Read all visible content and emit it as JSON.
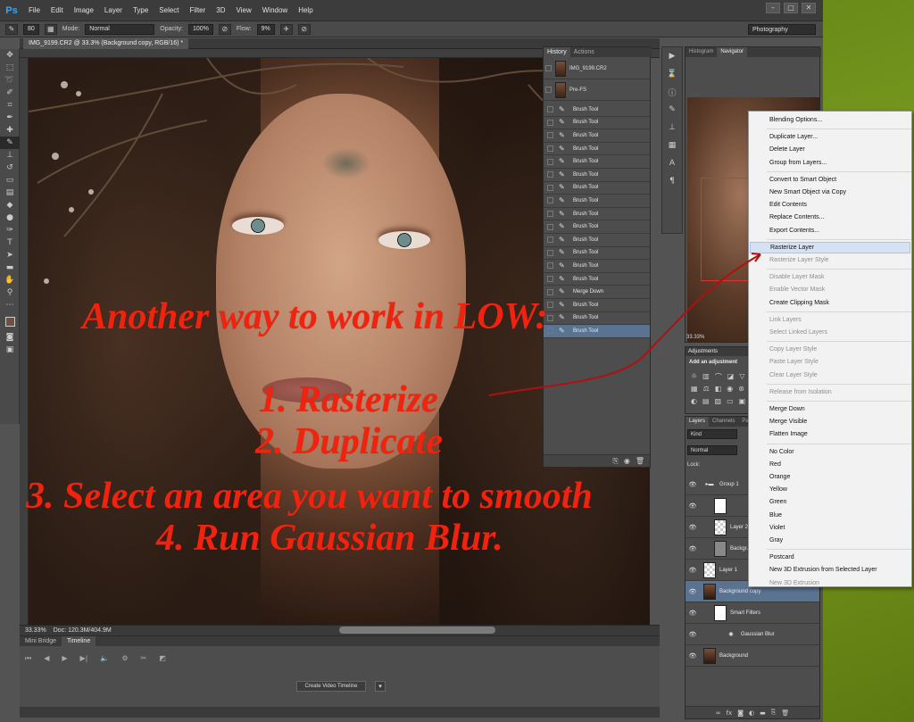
{
  "app": {
    "logo": "Ps"
  },
  "menubar": {
    "items": [
      "File",
      "Edit",
      "Image",
      "Layer",
      "Type",
      "Select",
      "Filter",
      "3D",
      "View",
      "Window",
      "Help"
    ]
  },
  "options_bar": {
    "brush_size": "80",
    "mode_label": "Mode:",
    "mode_value": "Normal",
    "opacity_label": "Opacity:",
    "opacity_value": "100%",
    "flow_label": "Flow:",
    "flow_value": "9%",
    "workspace": "Photography"
  },
  "document": {
    "tab_title": "IMG_9199.CR2 @ 33.3% (Background copy, RGB/16) *",
    "zoom": "33.33%",
    "doc_size": "Doc: 120.3M/404.9M"
  },
  "timeline": {
    "tabs": [
      "Mini Bridge",
      "Timeline"
    ],
    "create_button": "Create Video Timeline"
  },
  "history": {
    "tabs": [
      "History",
      "Actions"
    ],
    "snapshots": [
      "IMG_9199.CR2",
      "Pre-FS"
    ],
    "states": [
      "Brush Tool",
      "Brush Tool",
      "Brush Tool",
      "Brush Tool",
      "Brush Tool",
      "Brush Tool",
      "Brush Tool",
      "Brush Tool",
      "Brush Tool",
      "Brush Tool",
      "Brush Tool",
      "Brush Tool",
      "Brush Tool",
      "Brush Tool",
      "Merge Down",
      "Brush Tool",
      "Brush Tool",
      "Brush Tool"
    ],
    "selected_index": 17
  },
  "navigator": {
    "tabs": [
      "Histogram",
      "Navigator"
    ],
    "zoom": "33.33%"
  },
  "adjustments": {
    "tab": "Adjustments",
    "title": "Add an adjustment"
  },
  "layers": {
    "tabs": [
      "Layers",
      "Channels",
      "Paths"
    ],
    "filter": "Kind",
    "blend": "Normal",
    "lock_label": "Lock:",
    "rows": [
      {
        "name": "Group 1",
        "thumb": "none"
      },
      {
        "name": "",
        "thumb": "white"
      },
      {
        "name": "Layer 2",
        "thumb": "checker"
      },
      {
        "name": "Backgr...",
        "thumb": "gray"
      },
      {
        "name": "Layer 1",
        "thumb": "checker"
      },
      {
        "name": "Background copy",
        "thumb": "photo"
      },
      {
        "name": "Smart Filters",
        "thumb": "white"
      },
      {
        "name": "Gaussian Blur",
        "thumb": "none"
      },
      {
        "name": "Background",
        "thumb": "photo"
      }
    ],
    "selected_index": 5
  },
  "context_menu": {
    "groups": [
      [
        {
          "label": "Blending Options...",
          "enabled": true
        }
      ],
      [
        {
          "label": "Duplicate Layer...",
          "enabled": true
        },
        {
          "label": "Delete Layer",
          "enabled": true
        },
        {
          "label": "Group from Layers...",
          "enabled": true
        }
      ],
      [
        {
          "label": "Convert to Smart Object",
          "enabled": true
        },
        {
          "label": "New Smart Object via Copy",
          "enabled": true
        },
        {
          "label": "Edit Contents",
          "enabled": true
        },
        {
          "label": "Replace Contents...",
          "enabled": true
        },
        {
          "label": "Export Contents...",
          "enabled": true
        }
      ],
      [
        {
          "label": "Rasterize Layer",
          "enabled": true,
          "hover": true
        },
        {
          "label": "Rasterize Layer Style",
          "enabled": false
        }
      ],
      [
        {
          "label": "Disable Layer Mask",
          "enabled": false
        },
        {
          "label": "Enable Vector Mask",
          "enabled": false
        },
        {
          "label": "Create Clipping Mask",
          "enabled": true
        }
      ],
      [
        {
          "label": "Link Layers",
          "enabled": false
        },
        {
          "label": "Select Linked Layers",
          "enabled": false
        }
      ],
      [
        {
          "label": "Copy Layer Style",
          "enabled": false
        },
        {
          "label": "Paste Layer Style",
          "enabled": false
        },
        {
          "label": "Clear Layer Style",
          "enabled": false
        }
      ],
      [
        {
          "label": "Release from Isolation",
          "enabled": false
        }
      ],
      [
        {
          "label": "Merge Down",
          "enabled": true
        },
        {
          "label": "Merge Visible",
          "enabled": true
        },
        {
          "label": "Flatten Image",
          "enabled": true
        }
      ],
      [
        {
          "label": "No Color",
          "enabled": true
        },
        {
          "label": "Red",
          "enabled": true
        },
        {
          "label": "Orange",
          "enabled": true
        },
        {
          "label": "Yellow",
          "enabled": true
        },
        {
          "label": "Green",
          "enabled": true
        },
        {
          "label": "Blue",
          "enabled": true
        },
        {
          "label": "Violet",
          "enabled": true
        },
        {
          "label": "Gray",
          "enabled": true
        }
      ],
      [
        {
          "label": "Postcard",
          "enabled": true
        },
        {
          "label": "New 3D Extrusion from Selected Layer",
          "enabled": true
        },
        {
          "label": "New 3D Extrusion",
          "enabled": false
        }
      ]
    ]
  },
  "annotation": {
    "title": "Another way to work in LOW:",
    "step1": "1. Rasterize",
    "step2": "2. Duplicate",
    "step3": "3. Select an area you want to smooth",
    "step4": "4. Run Gaussian Blur.",
    "color": "#f0230f"
  },
  "colors": {
    "accent_selected": "#5a7391",
    "desktop_green": "#7ea21f"
  }
}
